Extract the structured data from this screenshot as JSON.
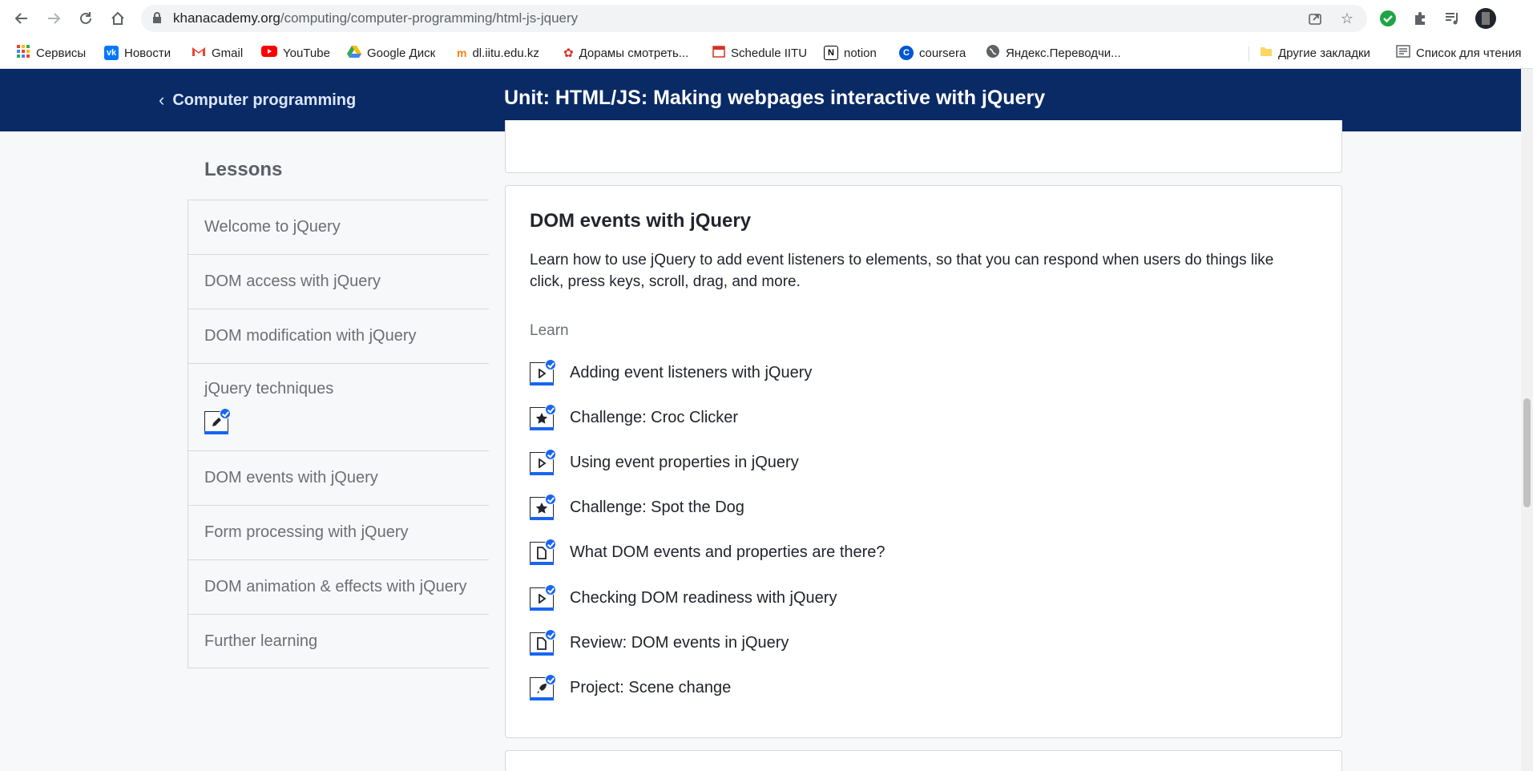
{
  "browser": {
    "url_host": "khanacademy.org",
    "url_path": "/computing/computer-programming/html-js-jquery",
    "bookmarks": [
      {
        "label": "Сервисы",
        "icon": "apps-grid-icon",
        "color": "#ea4335"
      },
      {
        "label": "Новости",
        "icon": "vk-icon",
        "color": "#0077ff"
      },
      {
        "label": "Gmail",
        "icon": "gmail-icon",
        "color": "#ea4335"
      },
      {
        "label": "YouTube",
        "icon": "youtube-icon",
        "color": "#ff0000"
      },
      {
        "label": "Google Диск",
        "icon": "google-drive-icon",
        "color": "#34a853"
      },
      {
        "label": "dl.iitu.edu.kz",
        "icon": "moodle-icon",
        "color": "#f98012"
      },
      {
        "label": "Дорамы смотреть...",
        "icon": "dorama-icon",
        "color": "#d93025"
      },
      {
        "label": "Schedule IITU",
        "icon": "calendar-icon",
        "color": "#d93025"
      },
      {
        "label": "notion",
        "icon": "notion-icon",
        "color": "#000000"
      },
      {
        "label": "coursera",
        "icon": "coursera-icon",
        "color": "#0056d2"
      },
      {
        "label": "Яндекс.Переводчи...",
        "icon": "globe-icon",
        "color": "#5f6368"
      }
    ],
    "other_bookmarks": "Другие закладки",
    "reading_list": "Список для чтения"
  },
  "header": {
    "back_label": "Computer programming",
    "unit_title": "Unit: HTML/JS: Making webpages interactive with jQuery",
    "background": "#0a2a66"
  },
  "sidebar": {
    "title": "Lessons",
    "items": [
      {
        "label": "Welcome to jQuery"
      },
      {
        "label": "DOM access with jQuery"
      },
      {
        "label": "DOM modification with jQuery"
      },
      {
        "label": "jQuery techniques"
      },
      {
        "label": "DOM events with jQuery"
      },
      {
        "label": "Form processing with jQuery"
      },
      {
        "label": "DOM animation & effects with jQuery"
      },
      {
        "label": "Further learning"
      }
    ]
  },
  "lesson": {
    "title": "DOM events with jQuery",
    "description": "Learn how to use jQuery to add event listeners to elements, so that you can respond when users do things like click, press keys, scroll, drag, and more.",
    "section_label": "Learn",
    "items": [
      {
        "label": "Adding event listeners with jQuery",
        "icon": "video-play-icon",
        "completed": true
      },
      {
        "label": "Challenge: Croc Clicker",
        "icon": "challenge-star-icon",
        "completed": true
      },
      {
        "label": "Using event properties in jQuery",
        "icon": "video-play-icon",
        "completed": true
      },
      {
        "label": "Challenge: Spot the Dog",
        "icon": "challenge-star-icon",
        "completed": true
      },
      {
        "label": "What DOM events and properties are there?",
        "icon": "article-icon",
        "completed": true
      },
      {
        "label": "Checking DOM readiness with jQuery",
        "icon": "video-play-icon",
        "completed": true
      },
      {
        "label": "Review: DOM events in jQuery",
        "icon": "article-icon",
        "completed": true
      },
      {
        "label": "Project: Scene change",
        "icon": "project-rocket-icon",
        "completed": true
      }
    ]
  },
  "colors": {
    "accent_blue": "#1865f2",
    "text_dark": "#21242c",
    "text_muted": "#6b6f75"
  }
}
